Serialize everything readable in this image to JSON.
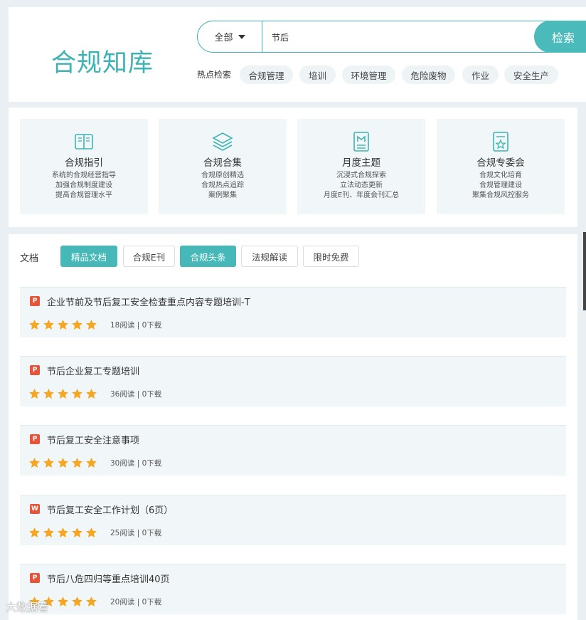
{
  "header": {
    "title": "合规知库",
    "search": {
      "scope": "全部",
      "query": "节后",
      "button": "检索"
    },
    "hot_label": "热点检索",
    "hot_tags": [
      "合规管理",
      "培训",
      "环境管理",
      "危险废物",
      "作业",
      "安全生产"
    ]
  },
  "categories": [
    {
      "icon": "book-icon",
      "title": "合规指引",
      "desc": [
        "系统的合规经营指导",
        "加强合规制度建设",
        "提高合规管理水平"
      ]
    },
    {
      "icon": "layers-icon",
      "title": "合规合集",
      "desc": [
        "合规原创精选",
        "合规热点追踪",
        "案例聚集"
      ]
    },
    {
      "icon": "magazine-icon",
      "title": "月度主题",
      "desc": [
        "沉浸式合规探索",
        "立法动态更新",
        "月度E刊、年度会刊汇总"
      ]
    },
    {
      "icon": "certificate-icon",
      "title": "合规专委会",
      "desc": [
        "合规文化培育",
        "合规管理建设",
        "聚集合规风控服务"
      ]
    }
  ],
  "docs": {
    "label": "文档",
    "tabs": [
      {
        "label": "精品文档",
        "active": true
      },
      {
        "label": "合规E刊",
        "active": false
      },
      {
        "label": "合规头条",
        "active": true
      },
      {
        "label": "法规解读",
        "active": false
      },
      {
        "label": "限时免费",
        "active": false
      }
    ],
    "items": [
      {
        "type": "ppt",
        "type_glyph": "P",
        "title": "企业节前及节后复工安全检查重点内容专题培训-T",
        "rating": 5,
        "meta": "18阅读 | 0下载"
      },
      {
        "type": "ppt",
        "type_glyph": "P",
        "title": "节后企业复工专题培训",
        "rating": 5,
        "meta": "36阅读 | 0下载"
      },
      {
        "type": "ppt",
        "type_glyph": "P",
        "title": "节后复工安全注意事项",
        "rating": 5,
        "meta": "30阅读 | 0下载"
      },
      {
        "type": "word",
        "type_glyph": "W",
        "title": "节后复工安全工作计划（6页）",
        "rating": 5,
        "meta": "25阅读 | 0下载"
      },
      {
        "type": "ppt",
        "type_glyph": "P",
        "title": "节后八危四归等重点培训40页",
        "rating": 5,
        "meta": "20阅读 | 0下载"
      }
    ]
  },
  "watermark": "大数据看",
  "colors": {
    "accent": "#4bbaba",
    "star": "#f5a623",
    "file_icon": "#e5553b"
  }
}
